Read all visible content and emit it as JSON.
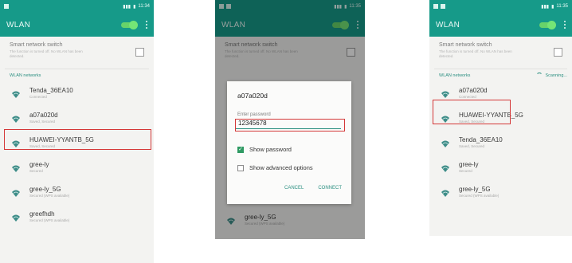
{
  "phone1": {
    "status_time": "11:34",
    "title": "WLAN",
    "smart_switch": {
      "title": "Smart network switch",
      "desc": "The function is turned off. No WLAN has been detected."
    },
    "section": "WLAN networks",
    "networks": [
      {
        "name": "Tenda_36EA10",
        "status": "Connected"
      },
      {
        "name": "a07a020d",
        "status": "Saved, Secured"
      },
      {
        "name": "HUAWEI-YYANTB_5G",
        "status": "Saved, Secured"
      },
      {
        "name": "gree-ly",
        "status": "Secured"
      },
      {
        "name": "gree-ly_5G",
        "status": "Secured (WPS available)"
      },
      {
        "name": "greefhdh",
        "status": "Secured (WPS available)"
      }
    ]
  },
  "phone2": {
    "status_time": "11:35",
    "title": "WLAN",
    "smart_switch": {
      "title": "Smart network switch",
      "desc": "The function is turned off. No WLAN has been detected."
    },
    "dialog": {
      "title": "a07a020d",
      "label": "Enter password",
      "password": "12345678",
      "show_password": "Show password",
      "show_advanced": "Show advanced options",
      "cancel": "CANCEL",
      "connect": "CONNECT"
    },
    "bottom_network": {
      "name": "gree-ly_5G",
      "status": "Secured (WPS available)"
    }
  },
  "phone3": {
    "status_time": "11:35",
    "title": "WLAN",
    "smart_switch": {
      "title": "Smart network switch",
      "desc": "The function is turned off. No WLAN has been detected."
    },
    "section": "WLAN networks",
    "scanning": "Scanning...",
    "networks": [
      {
        "name": "a07a020d",
        "status": "Connected"
      },
      {
        "name": "HUAWEI-YYANTB_5G",
        "status": "Saved, Secured"
      },
      {
        "name": "Tenda_36EA10",
        "status": "Saved, Secured"
      },
      {
        "name": "gree-ly",
        "status": "Secured"
      },
      {
        "name": "gree-ly_5G",
        "status": "Secured (WPS available)"
      }
    ]
  },
  "colors": {
    "accent": "#169a89",
    "highlight": "#d43838",
    "toggle": "#68d36a"
  }
}
